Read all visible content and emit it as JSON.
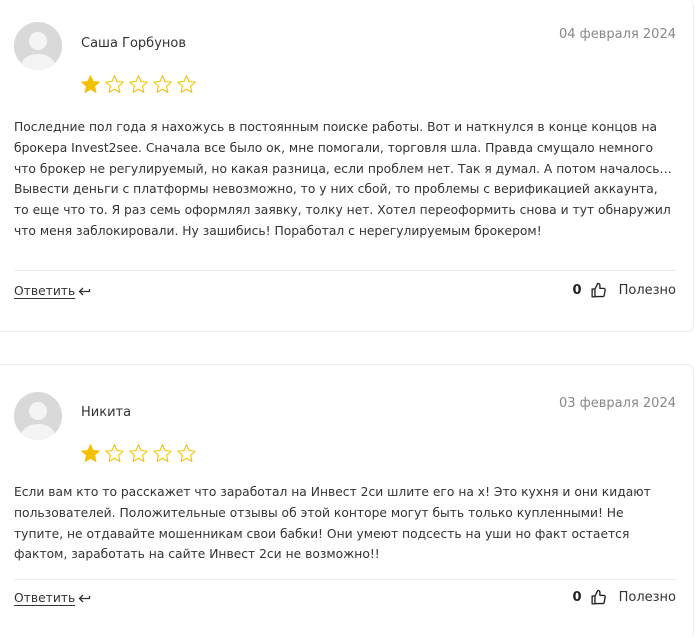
{
  "colors": {
    "star_filled": "#f2c200",
    "star_empty": "#f2c200",
    "date": "#888888"
  },
  "icons": {
    "rating": "star-icon",
    "reply": "reply-arrow-icon",
    "like": "thumbs-up-icon",
    "avatar": "user-avatar-icon"
  },
  "reviews": [
    {
      "author": "Саша Горбунов",
      "date": "04 февраля 2024",
      "rating": 1,
      "rating_max": 5,
      "text": "Последние пол года я нахожусь в постоянным поиске работы. Вот и наткнулся в конце концов на брокера Invest2see. Сначала все было ок, мне помогали, торговля шла. Правда смущало немного что брокер не регулируемый, но какая разница, если проблем нет. Так я думал. А потом началось… Вывести деньги с платформы невозможно, то у них сбой, то проблемы с верификацией аккаунта, то еще что то. Я раз семь оформлял заявку, толку нет. Хотел переоформить снова и тут обнаружил что меня заблокировали. Ну зашибись! Поработал с нерегулируемым брокером!",
      "reply_label": "Ответить",
      "helpful_count": "0",
      "helpful_label": "Полезно"
    },
    {
      "author": "Никита",
      "date": "03 февраля 2024",
      "rating": 1,
      "rating_max": 5,
      "text": "Если вам кто то расскажет что заработал на Инвест 2си шлите его на х! Это кухня и они кидают пользователей. Положительные отзывы об этой конторе могут быть только купленными! Не тупите, не отдавайте мошенникам свои бабки! Они умеют подсесть на уши но факт остается фактом, заработать на сайте Инвест 2си не возможно!!",
      "reply_label": "Ответить",
      "helpful_count": "0",
      "helpful_label": "Полезно"
    }
  ]
}
